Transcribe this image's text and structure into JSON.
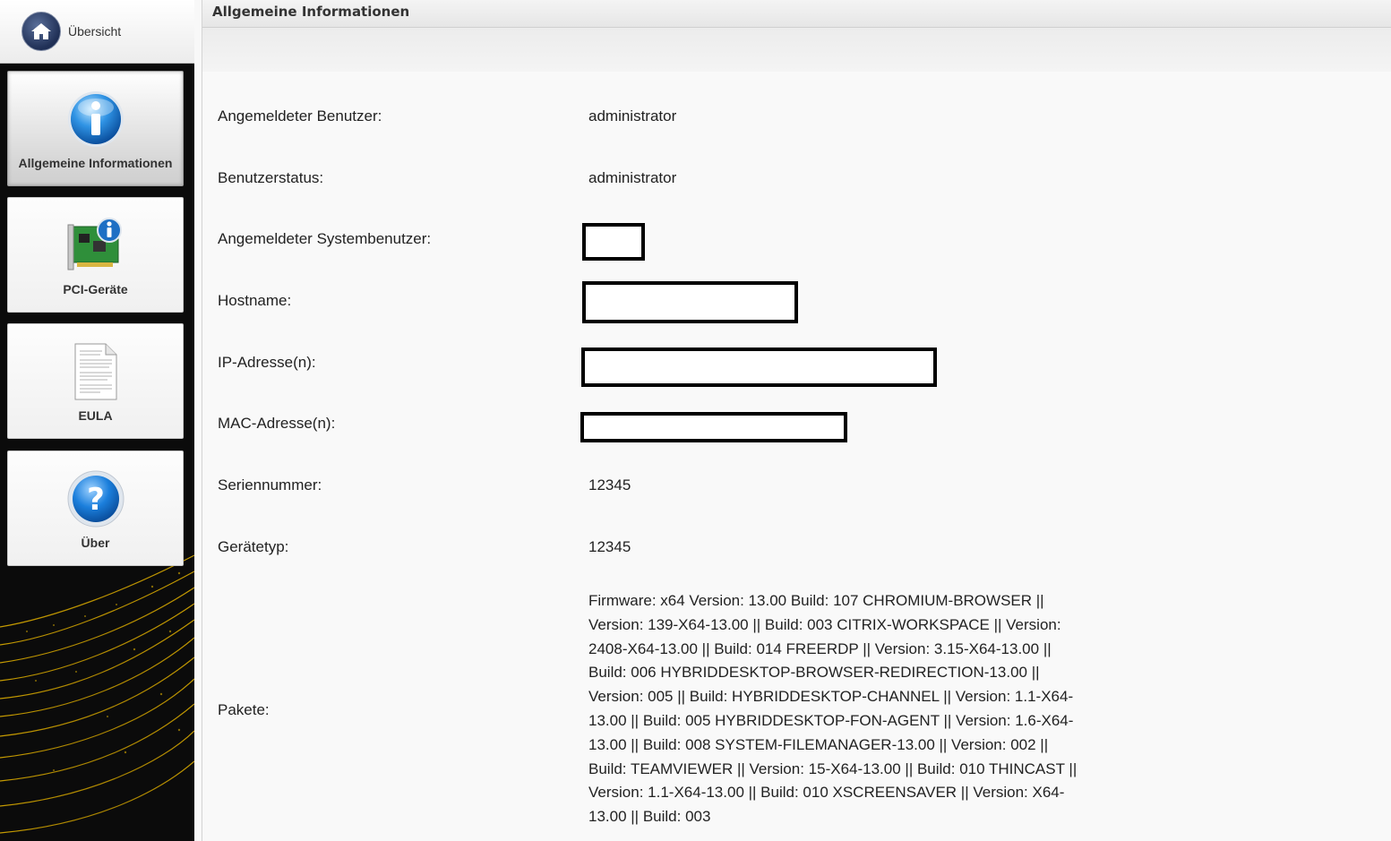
{
  "sidebar": {
    "home_label": "Übersicht",
    "tiles": [
      {
        "label": "Allgemeine Informationen",
        "icon": "info-icon",
        "active": true
      },
      {
        "label": "PCI-Geräte",
        "icon": "pci-card-icon",
        "active": false
      },
      {
        "label": "EULA",
        "icon": "document-icon",
        "active": false
      },
      {
        "label": "Über",
        "icon": "help-icon",
        "active": false
      }
    ]
  },
  "header": {
    "title": "Allgemeine Informationen"
  },
  "info": {
    "user_label": "Angemeldeter Benutzer:",
    "user_value": "administrator",
    "status_label": "Benutzerstatus:",
    "status_value": "administrator",
    "sysuser_label": "Angemeldeter Systembenutzer:",
    "hostname_label": "Hostname:",
    "ip_label": "IP-Adresse(n):",
    "mac_label": "MAC-Adresse(n):",
    "serial_label": "Seriennummer:",
    "serial_value": "12345",
    "devtype_label": "Gerätetyp:",
    "devtype_value": "12345",
    "packages_label": "Pakete:",
    "packages_value": "Firmware: x64 Version: 13.00 Build: 107 CHROMIUM-BROWSER || Version: 139-X64-13.00 || Build: 003 CITRIX-WORKSPACE || Version: 2408-X64-13.00 || Build: 014 FREERDP || Version: 3.15-X64-13.00 || Build: 006 HYBRIDDESKTOP-BROWSER-REDIRECTION-13.00 || Version: 005 || Build: HYBRIDDESKTOP-CHANNEL || Version: 1.1-X64-13.00 || Build: 005 HYBRIDDESKTOP-FON-AGENT || Version: 1.6-X64-13.00 || Build: 008 SYSTEM-FILEMANAGER-13.00 || Version: 002 || Build: TEAMVIEWER || Version: 15-X64-13.00 || Build: 010 THINCAST || Version: 1.1-X64-13.00 || Build: 010 XSCREENSAVER || Version: X64-13.00 || Build: 003"
  },
  "colors": {
    "accent_gold": "#e8b600",
    "sidebar_bg": "#0b0b0b",
    "home_icon_bg": "#1f2f55"
  }
}
